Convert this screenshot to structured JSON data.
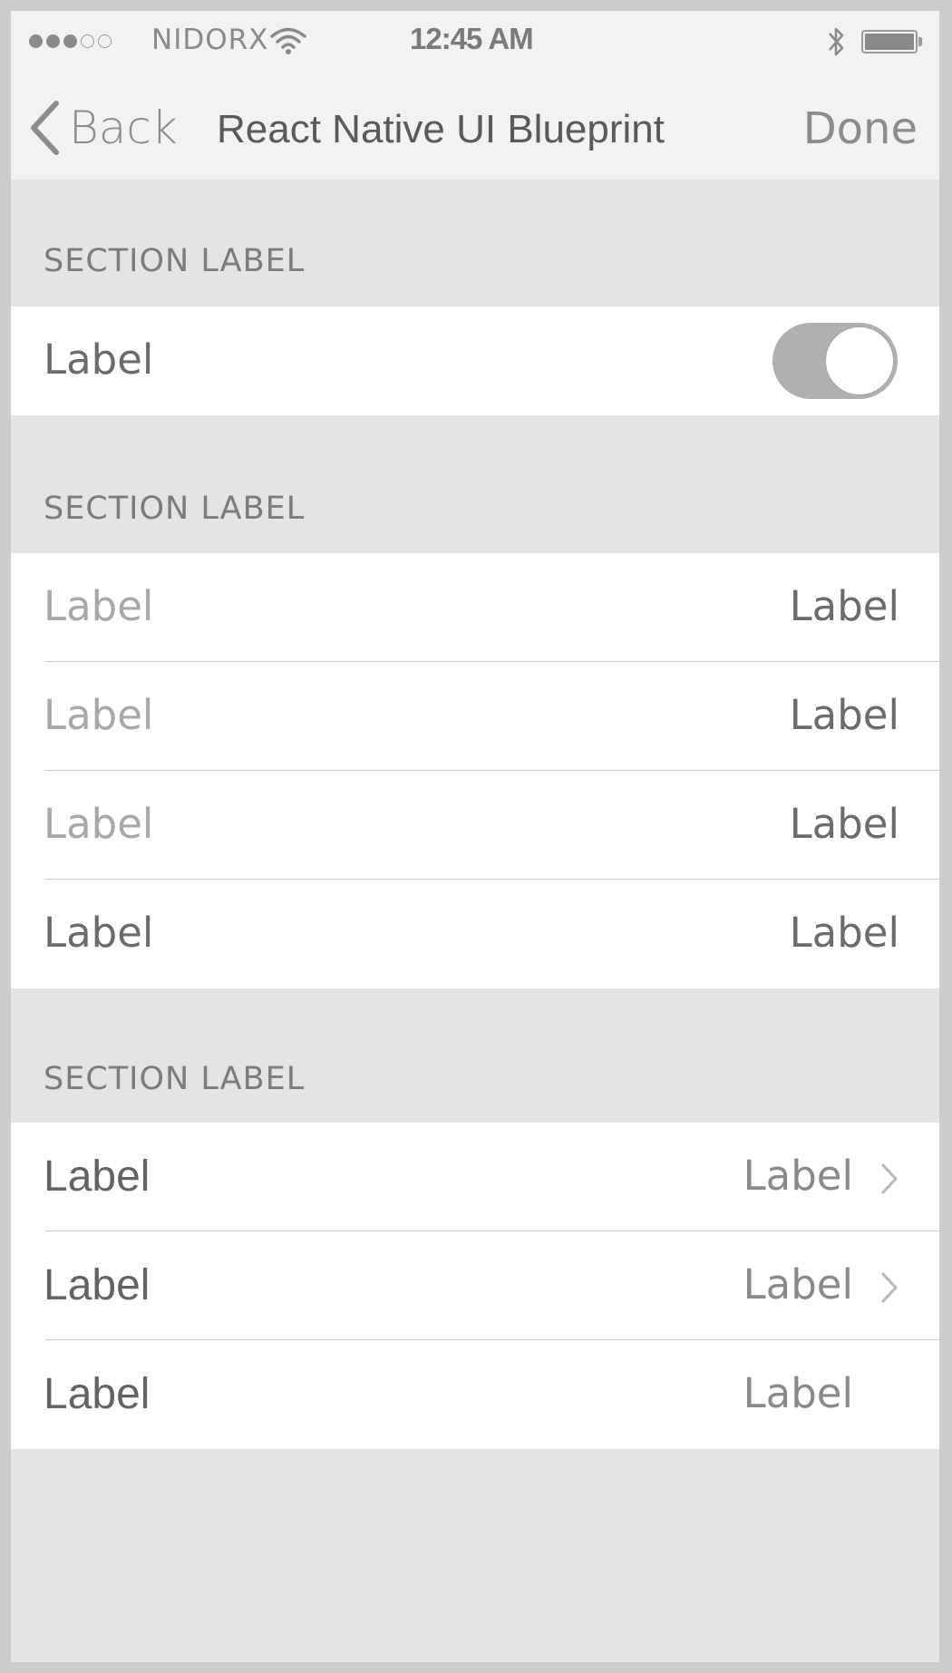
{
  "status_bar": {
    "carrier": "NIDORX",
    "time": "12:45 AM",
    "signal": [
      true,
      true,
      true,
      false,
      false
    ]
  },
  "nav": {
    "back_label": "Back",
    "title": "React Native UI Blueprint",
    "done_label": "Done"
  },
  "section1": {
    "header": "SECTION LABEL",
    "row": {
      "label": "Label",
      "toggle_on": true
    }
  },
  "section2": {
    "header": "SECTION LABEL",
    "rows": [
      {
        "label": "Label",
        "value": "Label"
      },
      {
        "label": "Label",
        "value": "Label"
      },
      {
        "label": "Label",
        "value": "Label"
      },
      {
        "label": "Label",
        "value": "Label"
      }
    ]
  },
  "section3": {
    "header": "SECTION LABEL",
    "rows": [
      {
        "label": "Label",
        "value": "Label",
        "chevron": true
      },
      {
        "label": "Label",
        "value": "Label",
        "chevron": true
      },
      {
        "label": "Label",
        "value": "Label",
        "chevron": false
      }
    ]
  },
  "icons": {
    "back": "chevron-left-icon",
    "wifi": "wifi-icon",
    "bluetooth": "bluetooth-icon",
    "battery": "battery-icon",
    "disclosure": "chevron-right-icon"
  },
  "colors": {
    "background": "#e4e4e4",
    "bar": "#f2f2f2",
    "cell": "#ffffff",
    "toggle_track": "#b0b0b0"
  }
}
